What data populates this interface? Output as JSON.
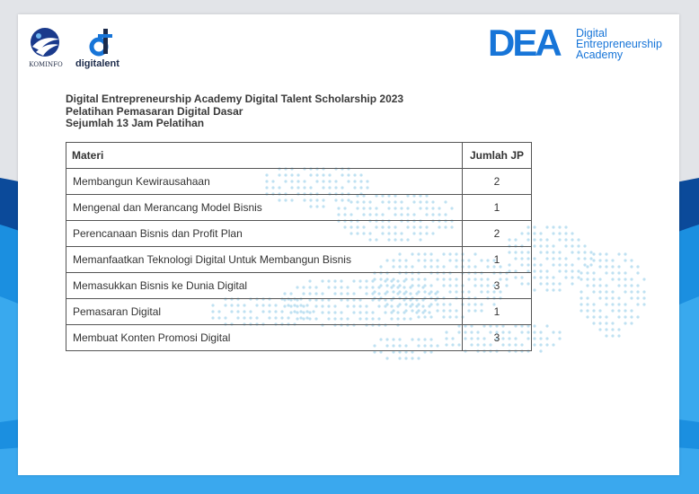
{
  "colors": {
    "accent_blue": "#1775d8",
    "dark_blue": "#0b4a9a",
    "dot_blue": "#bfe1f2"
  },
  "logos": {
    "kominfo": {
      "icon": "kominfo-emblem-icon",
      "text": "KOMINFO"
    },
    "digitalent": {
      "icon": "digitalent-d-icon",
      "text": "digitalent"
    },
    "dea": {
      "big": "DEA",
      "lines": [
        "Digital",
        "Entrepreneurship",
        "Academy"
      ]
    }
  },
  "heading": {
    "line1": "Digital Entrepreneurship Academy Digital Talent Scholarship 2023",
    "line2": "Pelatihan Pemasaran Digital Dasar",
    "line3": "Sejumlah 13 Jam Pelatihan"
  },
  "table": {
    "headers": {
      "materi": "Materi",
      "jp": "Jumlah JP"
    },
    "rows": [
      {
        "materi": "Membangun Kewirausahaan",
        "jp": "2"
      },
      {
        "materi": "Mengenal dan Merancang Model Bisnis",
        "jp": "1"
      },
      {
        "materi": "Perencanaan Bisnis dan Profit Plan",
        "jp": "2"
      },
      {
        "materi": "Memanfaatkan Teknologi Digital Untuk Membangun Bisnis",
        "jp": "1"
      },
      {
        "materi": "Memasukkan Bisnis ke Dunia Digital",
        "jp": "3"
      },
      {
        "materi": "Pemasaran Digital",
        "jp": "1"
      },
      {
        "materi": "Membuat Konten Promosi Digital",
        "jp": "3"
      }
    ]
  }
}
